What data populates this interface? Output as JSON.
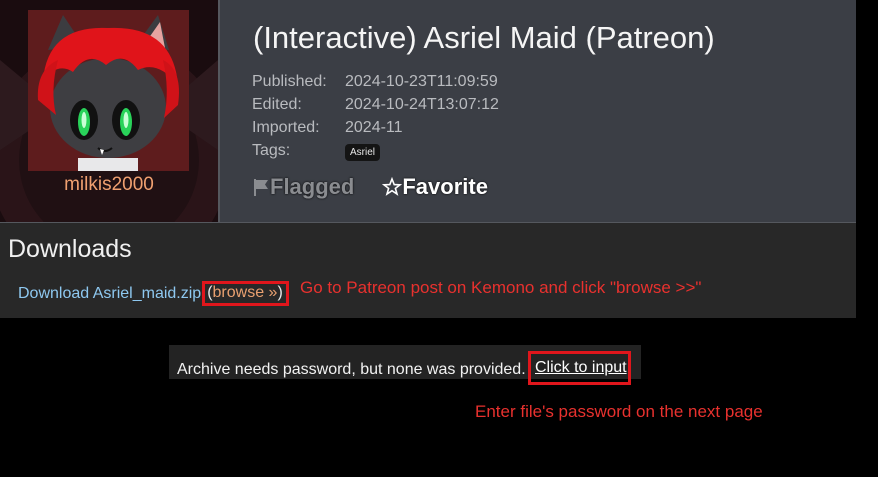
{
  "header": {
    "username": "milkis2000",
    "title": "(Interactive) Asriel Maid (Patreon)",
    "meta": [
      {
        "key": "Published:",
        "value": "2024-10-23T11:09:59"
      },
      {
        "key": "Edited:",
        "value": "2024-10-24T13:07:12"
      },
      {
        "key": "Imported:",
        "value": "2024-11"
      }
    ],
    "tags_label": "Tags:",
    "tags": [
      "Asriel"
    ],
    "flagged_label": "Flagged",
    "favorite_label": "Favorite",
    "flag_icon": "flag-icon",
    "star_icon": "star-icon"
  },
  "downloads": {
    "heading": "Downloads",
    "link_text": "Download Asriel_maid.zip",
    "browse_open": "(",
    "browse_label": "browse »",
    "browse_close": ")"
  },
  "annotations": {
    "step1": "Go to Patreon post on Kemono and click \"browse >>\"",
    "step2": "Enter file's password on the next page"
  },
  "notice": {
    "text": "Archive needs password, but none was provided.",
    "link": "Click to input"
  },
  "colors": {
    "highlight_box": "#e0161c",
    "annotation_text": "#e8312e",
    "link_blue": "#8ec8f0",
    "username_orange": "#f0a070"
  }
}
